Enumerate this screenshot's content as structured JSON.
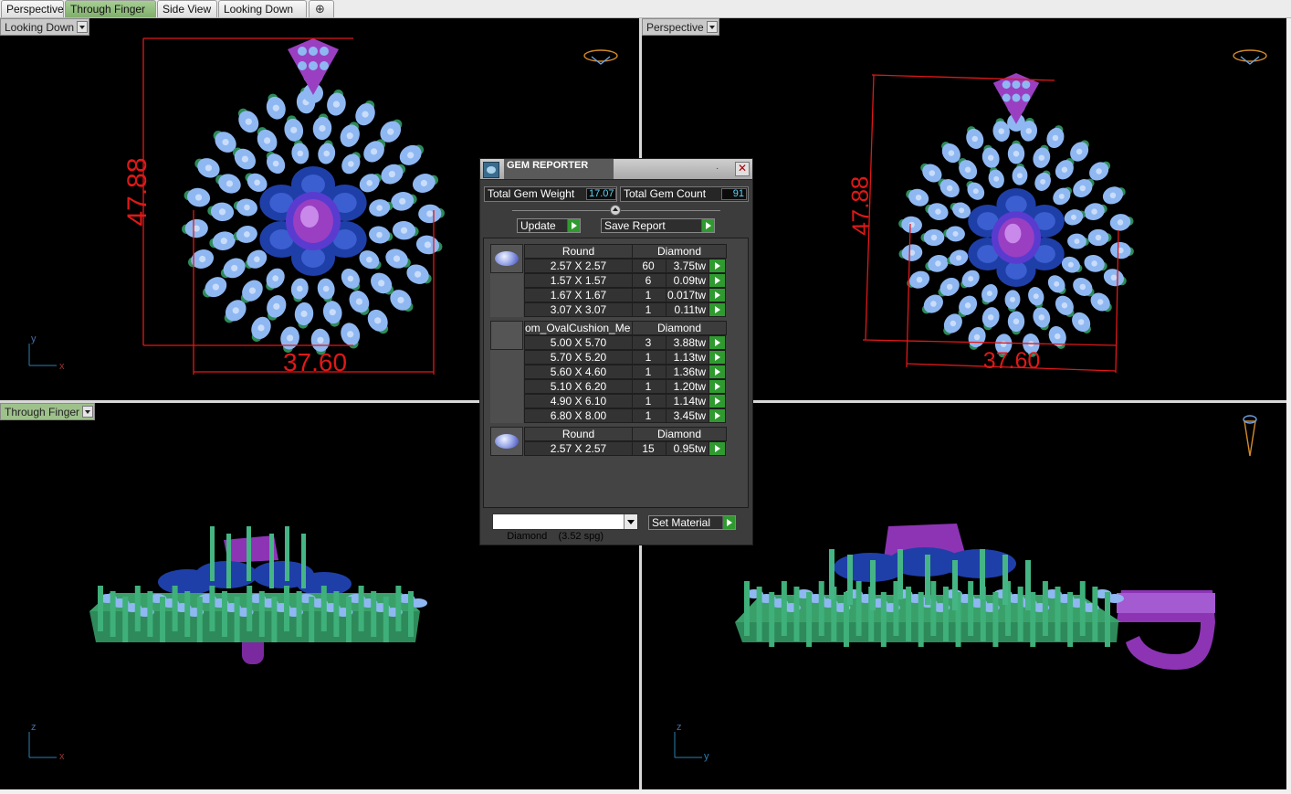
{
  "tabs": [
    {
      "label": "Perspective",
      "active": false
    },
    {
      "label": "Through Finger",
      "active": true
    },
    {
      "label": "Side View",
      "active": false
    },
    {
      "label": "Looking Down",
      "active": false
    }
  ],
  "add_tab_symbol": "⊕",
  "viewports": {
    "top_left": {
      "label": "Looking Down",
      "dim_height": "47.88",
      "dim_width": "37.60",
      "axis_v": "y",
      "axis_h": "x"
    },
    "top_right": {
      "label": "Perspective",
      "dim_height": "47.88",
      "dim_width": "37.60"
    },
    "bottom_left": {
      "label": "Through Finger",
      "axis_v": "z",
      "axis_h": "x"
    },
    "bottom_right": {
      "axis_v": "z",
      "axis_h": "y"
    }
  },
  "gem_reporter": {
    "title": "GEM REPORTER",
    "close_symbol": "✕",
    "total_weight_label": "Total Gem Weight",
    "total_weight": "17.07",
    "total_count_label": "Total Gem Count",
    "total_count": "91",
    "update_label": "Update",
    "save_report_label": "Save Report",
    "groups": [
      {
        "shape": "Round",
        "material": "Diamond",
        "thumbnail": "round-gem-icon",
        "rows": [
          {
            "size": "2.57 X 2.57",
            "count": "60",
            "weight": "3.75tw"
          },
          {
            "size": "1.57 X 1.57",
            "count": "6",
            "weight": "0.09tw"
          },
          {
            "size": "1.67 X 1.67",
            "count": "1",
            "weight": "0.017tw"
          },
          {
            "size": "3.07 X 3.07",
            "count": "1",
            "weight": "0.11tw"
          }
        ]
      },
      {
        "shape": "om_OvalCushion_Me",
        "material": "Diamond",
        "thumbnail": "blank-gem-icon",
        "rows": [
          {
            "size": "5.00 X 5.70",
            "count": "3",
            "weight": "3.88tw"
          },
          {
            "size": "5.70 X 5.20",
            "count": "1",
            "weight": "1.13tw"
          },
          {
            "size": "5.60 X 4.60",
            "count": "1",
            "weight": "1.36tw"
          },
          {
            "size": "5.10 X 6.20",
            "count": "1",
            "weight": "1.20tw"
          },
          {
            "size": "4.90 X 6.10",
            "count": "1",
            "weight": "1.14tw"
          },
          {
            "size": "6.80 X 8.00",
            "count": "1",
            "weight": "3.45tw"
          }
        ]
      },
      {
        "shape": "Round",
        "material": "Diamond",
        "thumbnail": "round-gem-icon",
        "rows": [
          {
            "size": "2.57 X 2.57",
            "count": "15",
            "weight": "0.95tw"
          }
        ]
      }
    ],
    "material_select": "Diamond    (3.52 spg)",
    "set_material_label": "Set Material"
  },
  "colors": {
    "viewport_bg": "#000000",
    "dimension_red": "#e01818",
    "gem_light_blue": "#8fb8f2",
    "gem_dark_blue": "#1f3fa8",
    "prong_green": "#2e8a5a",
    "center_purple": "#9a3fc2",
    "active_tab_green": "#8dbd78"
  }
}
